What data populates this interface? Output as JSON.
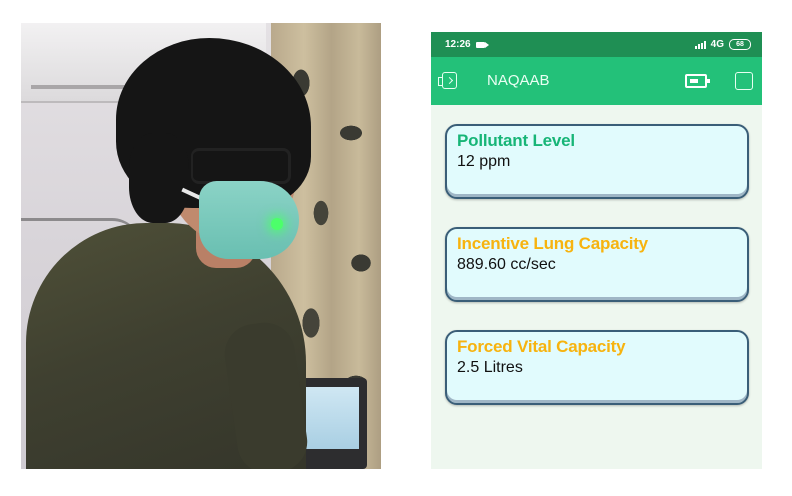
{
  "status_bar": {
    "time": "12:26",
    "network": "4G",
    "battery": "68"
  },
  "app_bar": {
    "title": "NAQAAB"
  },
  "cards": [
    {
      "title": "Pollutant Level",
      "value": "12 ppm",
      "title_color": "#17b577"
    },
    {
      "title": "Incentive Lung Capacity",
      "value": "889.60 cc/sec",
      "title_color": "#f7b30f"
    },
    {
      "title": "Forced Vital Capacity",
      "value": "2.5 Litres",
      "title_color": "#f7b30f"
    }
  ],
  "colors": {
    "status_bar": "#1f8f54",
    "app_bar": "#23c179",
    "card_background": "#e1fbfd",
    "card_border": "#3a5e78"
  },
  "icons": [
    "video-recording-icon",
    "signal-icon",
    "battery-icon",
    "device-connect-icon",
    "device-icon",
    "square-icon"
  ]
}
